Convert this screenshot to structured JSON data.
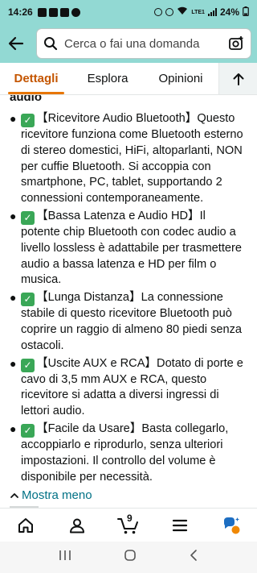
{
  "status_bar": {
    "time": "14:26",
    "network": "LTE1",
    "battery": "24%"
  },
  "header": {
    "search_placeholder": "Cerca o fai una domanda"
  },
  "tabs": [
    {
      "label": "Dettagli",
      "active": true
    },
    {
      "label": "Esplora",
      "active": false
    },
    {
      "label": "Opinioni",
      "active": false
    }
  ],
  "content": {
    "section_heading": "audio",
    "bullets": [
      {
        "text": "【Ricevitore Audio Bluetooth】Questo ricevitore funziona come Bluetooth esterno di stereo domestici, HiFi, altoparlanti, NON per cuffie Bluetooth. Si accoppia con smartphone, PC, tablet, supportando 2 connessioni contemporaneamente."
      },
      {
        "text": "【Bassa Latenza e Audio HD】Il potente chip Bluetooth con codec audio a livello lossless è adattabile per trasmettere audio a bassa latenza e HD per film o musica."
      },
      {
        "text": "【Lunga Distanza】La connessione stabile di questo ricevitore Bluetooth può coprire un raggio di almeno 80 piedi senza ostacoli."
      },
      {
        "text": "【Uscite AUX e RCA】Dotato di porte e cavo di 3,5 mm AUX e RCA, questo ricevitore si adatta a diversi ingressi di lettori audio."
      },
      {
        "text": "【Facile da Usare】Basta collegarlo, accoppiarlo e riprodurlo, senza ulteriori impostazioni. Il controllo del volume è disponibile per necessità."
      }
    ],
    "show_less_label": "Mostra meno"
  },
  "bottom_nav": {
    "cart_count": "9"
  },
  "colors": {
    "header_bg": "#92d9d3",
    "active_tab": "#c45500",
    "link": "#007185",
    "check": "#3aa757"
  }
}
